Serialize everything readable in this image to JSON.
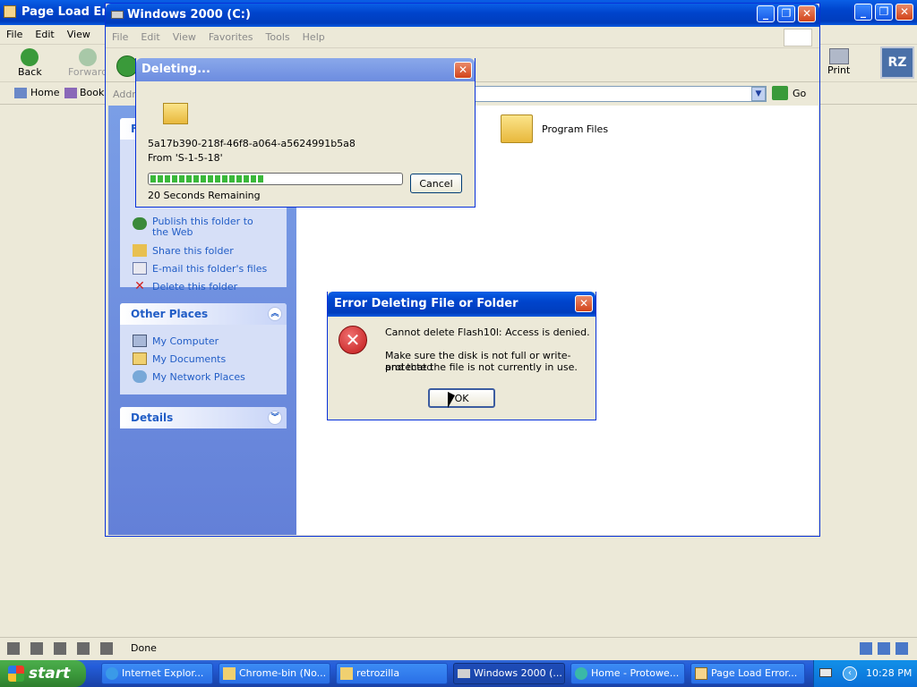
{
  "background_window": {
    "title": "Page Load Error",
    "menu": [
      "File",
      "Edit",
      "View"
    ],
    "toolbar": {
      "back": "Back",
      "forward": "Forward",
      "print": "Print"
    },
    "bookmarks": {
      "home": "Home",
      "bookmarks": "Bookm"
    },
    "status": "Done"
  },
  "explorer": {
    "title": "Windows 2000 (C:)",
    "menu": [
      "File",
      "Edit",
      "View",
      "Favorites",
      "Tools",
      "Help"
    ],
    "address_label": "Addre",
    "go_label": "Go",
    "file_tasks_header": "F",
    "file_tasks": [
      "Publish this folder to the Web",
      "Share this folder",
      "E-mail this folder's files",
      "Delete this folder"
    ],
    "other_places": {
      "header": "Other Places",
      "items": [
        "My Computer",
        "My Documents",
        "My Network Places"
      ]
    },
    "details_header": "Details",
    "folders": [
      {
        "name": "Program Files"
      }
    ]
  },
  "deleting_dialog": {
    "title": "Deleting...",
    "filename": "5a17b390-218f-46f8-a064-a5624991b5a8",
    "from": "From 'S-1-5-18'",
    "remaining": "20 Seconds Remaining",
    "progress": 0.45,
    "cancel": "Cancel"
  },
  "error_dialog": {
    "title": "Error Deleting File or Folder",
    "message": "Cannot delete Flash10l: Access is denied.",
    "detail_1": "Make sure the disk is not full or write-protected",
    "detail_2": "and that the file is not currently in use.",
    "ok": "OK"
  },
  "taskbar": {
    "start": "start",
    "tasks": [
      "Internet Explor...",
      "Chrome-bin (No...",
      "retrozilla",
      "Windows 2000 (...",
      "Home - Protowe...",
      "Page Load Error..."
    ],
    "clock": "10:28 PM"
  },
  "colors": {
    "accent": "#0a5fe6",
    "taskbar": "#245edb",
    "start": "#3c9a3c",
    "error": "#d0202a"
  }
}
